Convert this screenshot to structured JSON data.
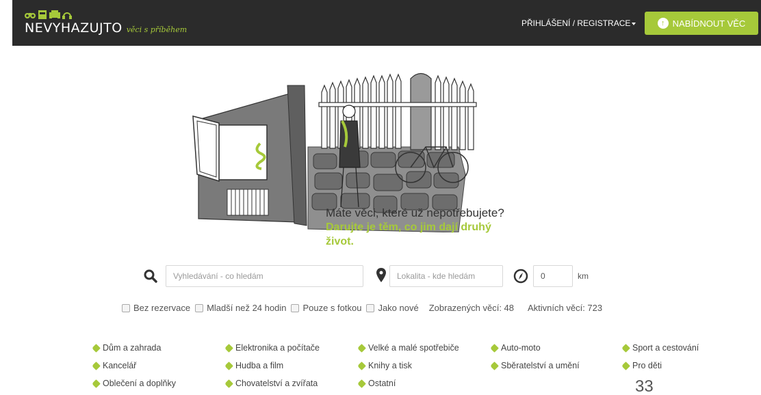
{
  "header": {
    "logo_title": "NEVYHAZUJTO",
    "logo_tagline": "věci s příběhem",
    "login_label": "PŘIHLÁŠENÍ / REGISTRACE",
    "offer_button": "NABÍDNOUT VĚC"
  },
  "hero": {
    "question": "Máte věci, které už nepotřebujete?",
    "answer": "Darujte je těm, co jim dají druhý život."
  },
  "search": {
    "query_placeholder": "Vyhledávání - co hledám",
    "location_placeholder": "Lokalita - kde hledám",
    "radius_value": "0",
    "radius_unit": "km"
  },
  "filters": {
    "items": [
      "Bez rezervace",
      "Mladší než 24 hodin",
      "Pouze s fotkou",
      "Jako nové"
    ],
    "shown_label": "Zobrazených věcí: 48",
    "active_label": "Aktivních věcí: 723"
  },
  "categories": [
    [
      "Dům a zahrada",
      "Elektronika a počítače",
      "Velké a malé spotřebiče",
      "Auto-moto",
      "Sport a cestování"
    ],
    [
      "Kancelář",
      "Hudba a film",
      "Knihy a tisk",
      "Sběratelství a umění",
      "Pro děti"
    ],
    [
      "Oblečení a doplňky",
      "Chovatelství a zvířata",
      "Ostatní"
    ]
  ],
  "page_number": "33",
  "colors": {
    "accent": "#a6c93a",
    "header_bg": "#2b2b2b"
  }
}
